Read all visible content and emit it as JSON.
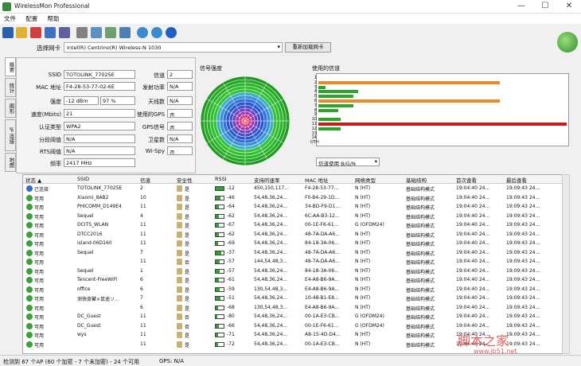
{
  "window": {
    "title": "WirelessMon Professional",
    "min": "—",
    "max": "☐",
    "close": "✕",
    "logo_icon": "wifi-globe-icon"
  },
  "menu": [
    "文件",
    "配置",
    "帮助"
  ],
  "toolbar_icons": [
    "save-icon",
    "open-folder-icon",
    "record-icon",
    "network-icon",
    "adapter-icon",
    "print-icon",
    "copy-icon",
    "checklist-icon",
    "export-icon",
    "globe-icon",
    "refresh-icon",
    "help-icon"
  ],
  "nic": {
    "label": "选择网卡",
    "value": "Intel(R) Centrino(R) Wireless-N 1030",
    "reload": "重新加载网卡"
  },
  "left_tabs": [
    "概要",
    "统计",
    "图形",
    "IP 连接",
    "地图"
  ],
  "info": {
    "ssid_label": "SSID",
    "ssid": "TOTOLINK_77025E",
    "mac_label": "MAC 地址",
    "mac": "F4-28-53-77-02-6E",
    "strength_label": "强度",
    "strength_dbm": "-12 dBm",
    "strength_pct": "97 %",
    "rate_label": "速度(Mbits)",
    "rate": "21",
    "auth_label": "认证类型",
    "auth": "WPA2",
    "frag_label": "分段阈值",
    "frag": "N/A",
    "rts_label": "RTS阈值",
    "rts": "N/A",
    "freq_label": "频率",
    "freq": "2417 MHz",
    "channel_label": "信道",
    "channel": "2",
    "txpower_label": "发射功率",
    "txpower": "N/A",
    "antenna_label": "天线数",
    "antenna": "N/A",
    "gps_use_label": "使用的GPS",
    "gps_use": "否",
    "gps_signal_label": "GPS信号",
    "gps_signal": "否",
    "sat_label": "卫星数",
    "sat": "N/A",
    "wispy_label": "Wi-Spy",
    "wispy": "否"
  },
  "radar": {
    "title": "信号强度"
  },
  "channels": {
    "title": "使用的信道",
    "labels": [
      "1",
      "2",
      "3",
      "4",
      "5",
      "6",
      "7",
      "8",
      "9",
      "10",
      "11",
      "12",
      "13",
      "14",
      "OTH"
    ],
    "bars": [
      {
        "ch": "2",
        "value": 0.73,
        "color": "#e88a2a"
      },
      {
        "ch": "3",
        "value": 0.03,
        "color": "#2da52d"
      },
      {
        "ch": "4",
        "value": 0.16,
        "color": "#2da52d"
      },
      {
        "ch": "5",
        "value": 0.14,
        "color": "#2da52d"
      },
      {
        "ch": "6",
        "value": 0.73,
        "color": "#e88a2a"
      },
      {
        "ch": "7",
        "value": 0.14,
        "color": "#2da52d"
      },
      {
        "ch": "8",
        "value": 0.08,
        "color": "#2da52d"
      },
      {
        "ch": "10",
        "value": 0.09,
        "color": "#2da52d"
      },
      {
        "ch": "11",
        "value": 1.0,
        "color": "#cc1a1a"
      },
      {
        "ch": "12",
        "value": 0.09,
        "color": "#2da52d"
      }
    ],
    "filter": "信道使用 B/G/N"
  },
  "table": {
    "headers": [
      "状态",
      "SSID",
      "信道",
      "安全性",
      "RSSI",
      "支持的速率",
      "MAC 地址",
      "网络类型",
      "基础结构",
      "首次查看",
      "最后查看"
    ],
    "rows": [
      {
        "status": "已连接",
        "connected": true,
        "ssid": "TOTOLINK_77025E",
        "ch": "2",
        "sec": "是",
        "rssi": "-12",
        "lvl": 0.97,
        "rates": "450,150,117...",
        "mac": "F4-28-53-77...",
        "type": "N (HT)",
        "infra": "基础结构模式",
        "first": "19:04:40 24...",
        "last": "19:09:43 24..."
      },
      {
        "status": "可用",
        "connected": false,
        "ssid": "Xiaomi_8AB2",
        "ch": "10",
        "sec": "是",
        "rssi": "-46",
        "lvl": 0.6,
        "rates": "54,48,36,24...",
        "mac": "F0-B4-29-1D...",
        "type": "N (HT)",
        "infra": "基础结构模式",
        "first": "19:04:40 24...",
        "last": "19:09:43 24..."
      },
      {
        "status": "可用",
        "connected": false,
        "ssid": "PHICOMM_D149E4",
        "ch": "11",
        "sec": "是",
        "rssi": "-64",
        "lvl": 0.4,
        "rates": "54,48,36,24...",
        "mac": "34-BD-F9-D1...",
        "type": "N (HT)",
        "infra": "基础结构模式",
        "first": "19:04:40 24...",
        "last": "19:09:43 24..."
      },
      {
        "status": "可用",
        "connected": false,
        "ssid": "Sequel",
        "ch": "4",
        "sec": "是",
        "rssi": "-62",
        "lvl": 0.42,
        "rates": "54,48,36,24...",
        "mac": "6C-AA-B3-12...",
        "type": "N (HT)",
        "infra": "基础结构模式",
        "first": "19:04:40 24...",
        "last": "19:09:43 24..."
      },
      {
        "status": "可用",
        "connected": false,
        "ssid": "DCITS_WLAN",
        "ch": "11",
        "sec": "是",
        "rssi": "-67",
        "lvl": 0.35,
        "rates": "54,48,36,24...",
        "mac": "00-1E-F6-61...",
        "type": "G (OFDM24)",
        "infra": "基础结构模式",
        "first": "19:04:40 24...",
        "last": "19:09:43 24..."
      },
      {
        "status": "可用",
        "connected": false,
        "ssid": "DTCC2016",
        "ch": "11",
        "sec": "是",
        "rssi": "-62",
        "lvl": 0.42,
        "rates": "54,48,36,24...",
        "mac": "48-7A-DA-A6...",
        "type": "N (HT)",
        "infra": "基础结构模式",
        "first": "19:04:40 24...",
        "last": "19:09:43 24..."
      },
      {
        "status": "可用",
        "connected": false,
        "ssid": "island-06D160",
        "ch": "11",
        "sec": "是",
        "rssi": "-69",
        "lvl": 0.33,
        "rates": "54,48,36,24...",
        "mac": "84-18-3A-06...",
        "type": "N (HT)",
        "infra": "基础结构模式",
        "first": "19:04:40 24...",
        "last": "19:09:43 24..."
      },
      {
        "status": "可用",
        "connected": false,
        "ssid": "Sequel",
        "ch": "7",
        "sec": "是",
        "rssi": "-37",
        "lvl": 0.7,
        "rates": "54,48,36,24...",
        "mac": "48-7A-DA-A6...",
        "type": "N (HT)",
        "infra": "基础结构模式",
        "first": "19:04:40 24...",
        "last": "19:09:43 24..."
      },
      {
        "status": "可用",
        "connected": false,
        "ssid": "",
        "ch": "11",
        "sec": "否",
        "rssi": "-57",
        "lvl": 0.48,
        "rates": "144,54,48,3...",
        "mac": "48-7A-DA-A6...",
        "type": "N (HT)",
        "infra": "基础结构模式",
        "first": "19:04:40 24...",
        "last": "19:09:43 24..."
      },
      {
        "status": "可用",
        "connected": false,
        "ssid": "Sequel",
        "ch": "1",
        "sec": "是",
        "rssi": "-57",
        "lvl": 0.48,
        "rates": "54,48,36,24...",
        "mac": "84-18-3A-06...",
        "type": "N (HT)",
        "infra": "基础结构模式",
        "first": "19:04:40 24...",
        "last": "19:09:43 24..."
      },
      {
        "status": "可用",
        "connected": false,
        "ssid": "Tencent-FreeWiFi",
        "ch": "6",
        "sec": "是",
        "rssi": "-61",
        "lvl": 0.43,
        "rates": "54,48,36,24...",
        "mac": "E4-A8-B6-9A...",
        "type": "N (HT)",
        "infra": "基础结构模式",
        "first": "19:04:40 24...",
        "last": "19:09:43 24..."
      },
      {
        "status": "可用",
        "connected": false,
        "ssid": "office",
        "ch": "6",
        "sec": "是",
        "rssi": "-59",
        "lvl": 0.45,
        "rates": "130,54,48,3...",
        "mac": "E4-A8-B6-9A...",
        "type": "N (HT)",
        "infra": "基础结构模式",
        "first": "19:04:40 24...",
        "last": "19:09:43 24..."
      },
      {
        "status": "可用",
        "connected": false,
        "ssid": "测快背鼙×鼠遥ソ...",
        "ch": "7",
        "sec": "是",
        "rssi": "-51",
        "lvl": 0.55,
        "rates": "54,48,36,24...",
        "mac": "10-48-B1-E8...",
        "type": "N (HT)",
        "infra": "基础结构模式",
        "first": "19:04:40 24...",
        "last": "19:09:43 24..."
      },
      {
        "status": "可用",
        "connected": false,
        "ssid": "",
        "ch": "6",
        "sec": "是",
        "rssi": "-68",
        "lvl": 0.34,
        "rates": "130,54,48,3...",
        "mac": "E4-A8-B6-9A...",
        "type": "N (HT)",
        "infra": "基础结构模式",
        "first": "19:04:40 24...",
        "last": "19:09:43 24..."
      },
      {
        "status": "可用",
        "connected": false,
        "ssid": "DC_Guest",
        "ch": "11",
        "sec": "否",
        "rssi": "-80",
        "lvl": 0.2,
        "rates": "54,48,36,24...",
        "mac": "00-1A-E3-CB...",
        "type": "G (OFDM24)",
        "infra": "基础结构模式",
        "first": "19:04:40 24...",
        "last": "19:09:43 24..."
      },
      {
        "status": "可用",
        "connected": false,
        "ssid": "DC_Guest",
        "ch": "11",
        "sec": "否",
        "rssi": "-66",
        "lvl": 0.36,
        "rates": "54,48,36,24...",
        "mac": "00-1E-F6-61...",
        "type": "G (OFDM24)",
        "infra": "基础结构模式",
        "first": "19:04:40 24...",
        "last": "19:09:43 24..."
      },
      {
        "status": "可用",
        "connected": false,
        "ssid": "wys",
        "ch": "11",
        "sec": "是",
        "rssi": "-71",
        "lvl": 0.3,
        "rates": "54,48,36,24...",
        "mac": "A8-15-4D-D4...",
        "type": "N (HT)",
        "infra": "基础结构模式",
        "first": "19:04:40 24...",
        "last": "19:09:43 24..."
      },
      {
        "status": "可用",
        "connected": false,
        "ssid": "",
        "ch": "11",
        "sec": "是",
        "rssi": "-72",
        "lvl": 0.29,
        "rates": "54,48,36,24...",
        "mac": "00-1A-E3-CB...",
        "type": "N (HT)",
        "infra": "基础结构模式",
        "first": "19:04:40 24...",
        "last": "19:09:43 24..."
      }
    ]
  },
  "status": {
    "ap": "检测到 67 个AP (60 个加密 - 7 个未加密) - 24 个可用",
    "gps": "GPS: N/A"
  },
  "watermark": {
    "cn": "脚本之家",
    "url": "www.jb51.net"
  }
}
